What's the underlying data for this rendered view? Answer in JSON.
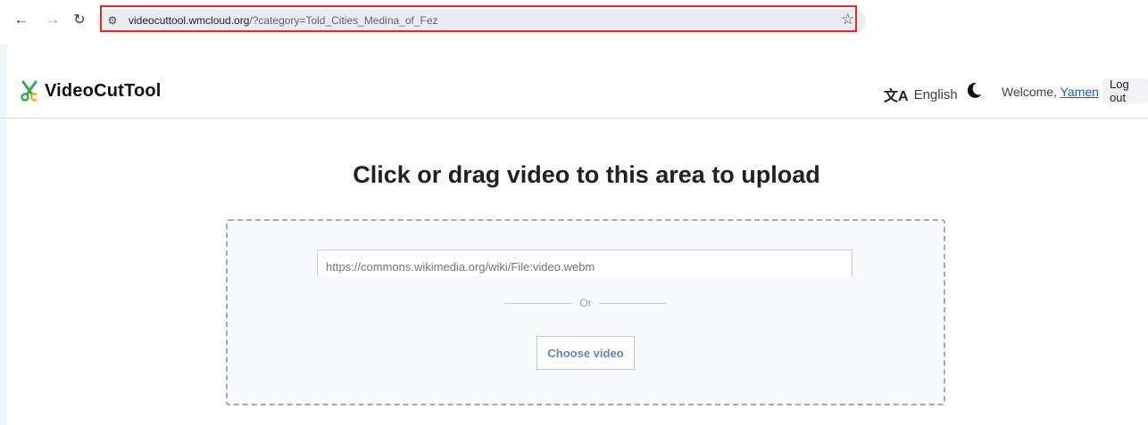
{
  "browser": {
    "url_domain": "videocuttool.wmcloud.org",
    "url_path": "/?category=Told_Cities_Medina_of_Fez",
    "back_icon": "arrow-left-icon",
    "forward_icon": "arrow-right-icon",
    "reload_icon": "reload-icon",
    "site_info_icon": "tune-icon",
    "bookmark_icon": "star-icon",
    "highlight_color": "#d93025"
  },
  "header": {
    "logo_text": "VideoCutTool",
    "language": "English",
    "theme_icon": "moon-icon",
    "welcome_prefix": "Welcome, ",
    "username": "Yamen",
    "logout_label": "Log out"
  },
  "upload": {
    "heading": "Click or drag video to this area to upload",
    "url_placeholder": "https://commons.wikimedia.org/wiki/File:video.webm",
    "or_label": "Or",
    "choose_label": "Choose video",
    "accent_color": "#5b88c8"
  }
}
